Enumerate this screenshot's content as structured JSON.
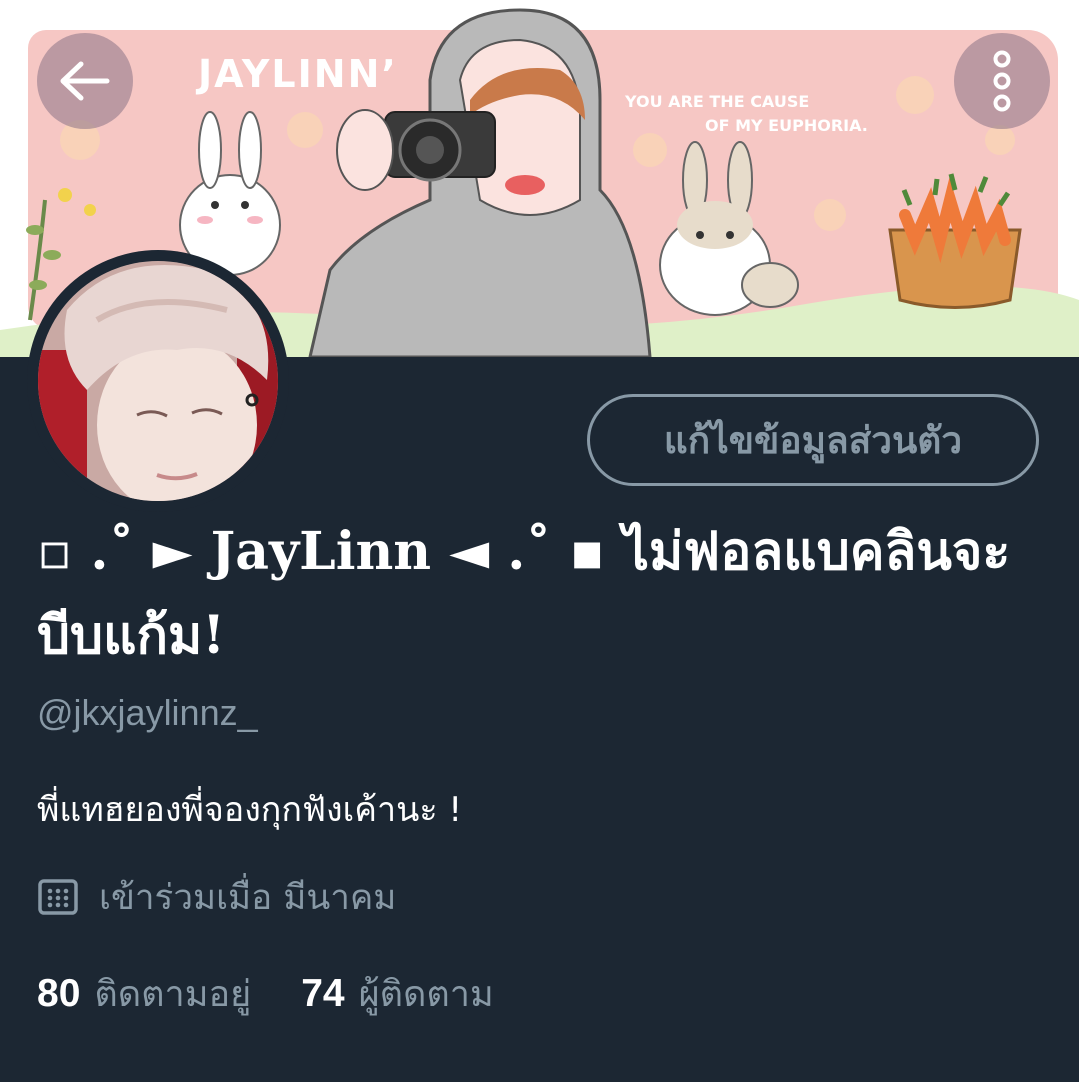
{
  "header": {
    "back_icon": "arrow-left-icon",
    "more_icon": "vertical-dots-icon",
    "banner": {
      "title": "JAYLINN’",
      "tagline_line1": "YOU ARE THE CAUSE",
      "tagline_line2": "OF MY EUPHORIA."
    }
  },
  "profile": {
    "edit_button_label": "แก้ไขข้อมูลส่วนตัว",
    "display_name": "▫ .˚ ► JayLinn ◄ .˚ ▪ ไม่ฟอลแบคลินจะบีบแก้ม!",
    "handle": "@jkxjaylinnz_",
    "bio": "พี่แทฮยองพี่จองกุกฟังเค้านะ !",
    "joined_icon": "calendar-icon",
    "joined_text": "เข้าร่วมเมื่อ มีนาคม",
    "following_count": "80",
    "following_label": "ติดตามอยู่",
    "followers_count": "74",
    "followers_label": "ผู้ติดตาม"
  },
  "colors": {
    "background": "#1c2733",
    "text_primary": "#ffffff",
    "text_secondary": "#8899a6",
    "banner_pink": "#f6c7c4"
  }
}
